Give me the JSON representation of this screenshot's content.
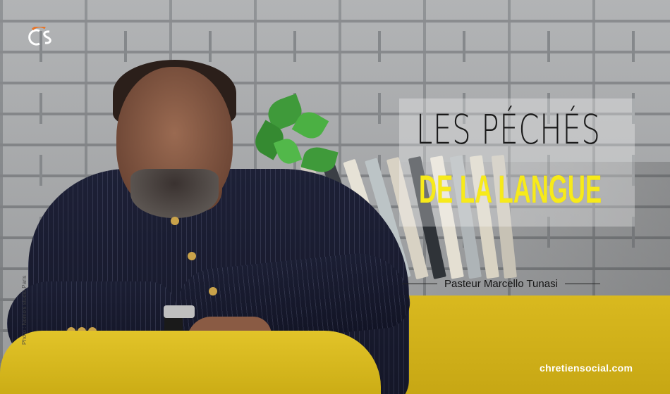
{
  "brand": {
    "logo_text": "CS",
    "logo_icon": "cs-logo-icon",
    "website": "chretiensocial.com"
  },
  "headline": {
    "line1": "LES PÉCHÉS",
    "line2": "DE LA LANGUE"
  },
  "byline": {
    "name": "Pasteur Marcello Tunasi"
  },
  "photo_credit": "Photo : Nomo's studio Paris",
  "colors": {
    "accent_yellow": "#f7ea1a",
    "sofa_yellow": "#d6b71d",
    "jacket_navy": "#181a2e"
  }
}
